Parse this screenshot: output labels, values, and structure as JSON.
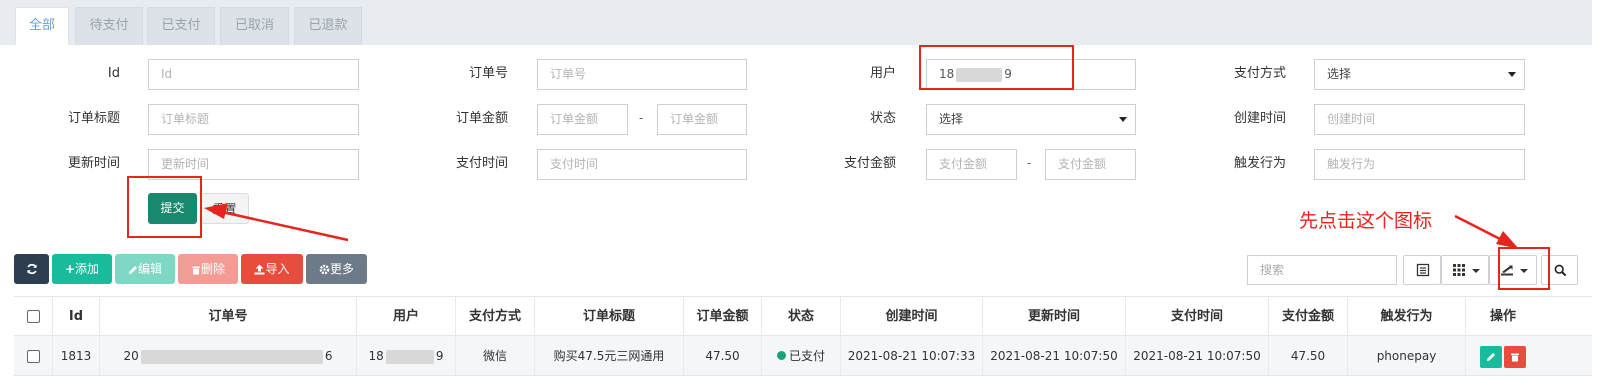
{
  "tabs": [
    "全部",
    "待支付",
    "已支付",
    "已取消",
    "已退款"
  ],
  "form": {
    "id": {
      "label": "Id",
      "placeholder": "Id"
    },
    "order_no": {
      "label": "订单号",
      "placeholder": "订单号"
    },
    "user": {
      "label": "用户",
      "value_prefix": "18",
      "value_suffix": "9"
    },
    "pay_method": {
      "label": "支付方式",
      "value": "选择"
    },
    "order_title": {
      "label": "订单标题",
      "placeholder": "订单标题"
    },
    "order_amount": {
      "label": "订单金额",
      "placeholder_from": "订单金额",
      "placeholder_to": "订单金额",
      "sep": "-"
    },
    "status": {
      "label": "状态",
      "value": "选择"
    },
    "create_time": {
      "label": "创建时间",
      "placeholder": "创建时间"
    },
    "update_time": {
      "label": "更新时间",
      "placeholder": "更新时间"
    },
    "pay_time": {
      "label": "支付时间",
      "placeholder": "支付时间"
    },
    "pay_amount": {
      "label": "支付金额",
      "placeholder_from": "支付金额",
      "placeholder_to": "支付金额",
      "sep": "-"
    },
    "trigger": {
      "label": "触发行为",
      "placeholder": "触发行为"
    },
    "submit_label": "提交",
    "reset_label": "重置"
  },
  "toolbar": {
    "add_label": "添加",
    "edit_label": "编辑",
    "delete_label": "删除",
    "import_label": "导入",
    "more_label": "更多",
    "search_placeholder": "搜索"
  },
  "annotation": {
    "text": "先点击这个图标"
  },
  "table": {
    "columns": [
      "Id",
      "订单号",
      "用户",
      "支付方式",
      "订单标题",
      "订单金额",
      "状态",
      "创建时间",
      "更新时间",
      "支付时间",
      "支付金额",
      "触发行为",
      "操作"
    ],
    "rows": [
      {
        "id": "1813",
        "order_no_prefix": "20",
        "order_no_suffix": "6",
        "user_prefix": "18",
        "user_suffix": "9",
        "pay_method": "微信",
        "title": "购买47.5元三网通用",
        "amount": "47.50",
        "status": "已支付",
        "create_time": "2021-08-21 10:07:33",
        "update_time": "2021-08-21 10:07:50",
        "pay_time": "2021-08-21 10:07:50",
        "pay_amount": "47.50",
        "trigger": "phonepay"
      }
    ]
  },
  "colors": {
    "submit": "#18896e",
    "dark_btn": "#2c3e50",
    "add": "#18bc9c",
    "edit": "#7fd8c4",
    "delete": "#f39c96",
    "import": "#e74c3c",
    "more": "#6c7a89",
    "annotation": "#e8241e"
  }
}
